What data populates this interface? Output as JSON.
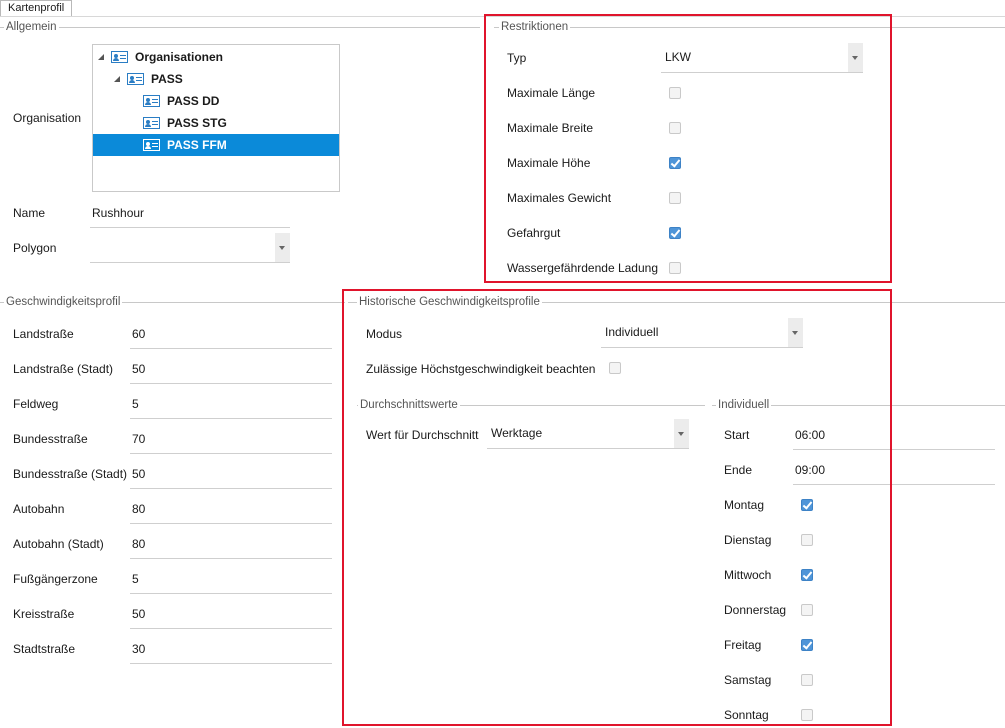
{
  "tab": {
    "label": "Kartenprofil"
  },
  "allgemein": {
    "title": "Allgemein",
    "organisation_label": "Organisation",
    "tree": [
      {
        "label": "Organisationen",
        "level": 0,
        "expanded": true,
        "selected": false
      },
      {
        "label": "PASS",
        "level": 1,
        "expanded": true,
        "selected": false
      },
      {
        "label": "PASS DD",
        "level": 2,
        "selected": false
      },
      {
        "label": "PASS STG",
        "level": 2,
        "selected": false
      },
      {
        "label": "PASS FFM",
        "level": 2,
        "selected": true
      }
    ],
    "name_label": "Name",
    "name_value": "Rushhour",
    "polygon_label": "Polygon",
    "polygon_value": ""
  },
  "restriktionen": {
    "title": "Restriktionen",
    "typ_label": "Typ",
    "typ_value": "LKW",
    "items": [
      {
        "label": "Maximale Länge",
        "checked": false
      },
      {
        "label": "Maximale Breite",
        "checked": false
      },
      {
        "label": "Maximale Höhe",
        "checked": true
      },
      {
        "label": "Maximales Gewicht",
        "checked": false
      },
      {
        "label": "Gefahrgut",
        "checked": true
      },
      {
        "label": "Wassergefährdende Ladung",
        "checked": false
      }
    ]
  },
  "geschwindigkeit": {
    "title": "Geschwindigkeitsprofil",
    "rows": [
      {
        "label": "Landstraße",
        "value": "60"
      },
      {
        "label": "Landstraße (Stadt)",
        "value": "50"
      },
      {
        "label": "Feldweg",
        "value": "5"
      },
      {
        "label": "Bundesstraße",
        "value": "70"
      },
      {
        "label": "Bundesstraße (Stadt)",
        "value": "50"
      },
      {
        "label": "Autobahn",
        "value": "80"
      },
      {
        "label": "Autobahn (Stadt)",
        "value": "80"
      },
      {
        "label": "Fußgängerzone",
        "value": "5"
      },
      {
        "label": "Kreisstraße",
        "value": "50"
      },
      {
        "label": "Stadtstraße",
        "value": "30"
      }
    ]
  },
  "historisch": {
    "title": "Historische Geschwindigkeitsprofile",
    "modus_label": "Modus",
    "modus_value": "Individuell",
    "hoechst_label": "Zulässige Höchstgeschwindigkeit beachten",
    "hoechst_checked": false,
    "durchschnitt": {
      "title": "Durchschnittswerte",
      "wert_label": "Wert für Durchschnitt",
      "wert_value": "Werktage"
    },
    "individuell": {
      "title": "Individuell",
      "start_label": "Start",
      "start_value": "06:00",
      "ende_label": "Ende",
      "ende_value": "09:00",
      "days": [
        {
          "label": "Montag",
          "checked": true
        },
        {
          "label": "Dienstag",
          "checked": false
        },
        {
          "label": "Mittwoch",
          "checked": true
        },
        {
          "label": "Donnerstag",
          "checked": false
        },
        {
          "label": "Freitag",
          "checked": true
        },
        {
          "label": "Samstag",
          "checked": false
        },
        {
          "label": "Sonntag",
          "checked": false
        }
      ]
    }
  },
  "colors": {
    "accent": "#0b8ad9",
    "highlight_box": "#e0142c",
    "checkbox_on": "#4f95d8"
  }
}
